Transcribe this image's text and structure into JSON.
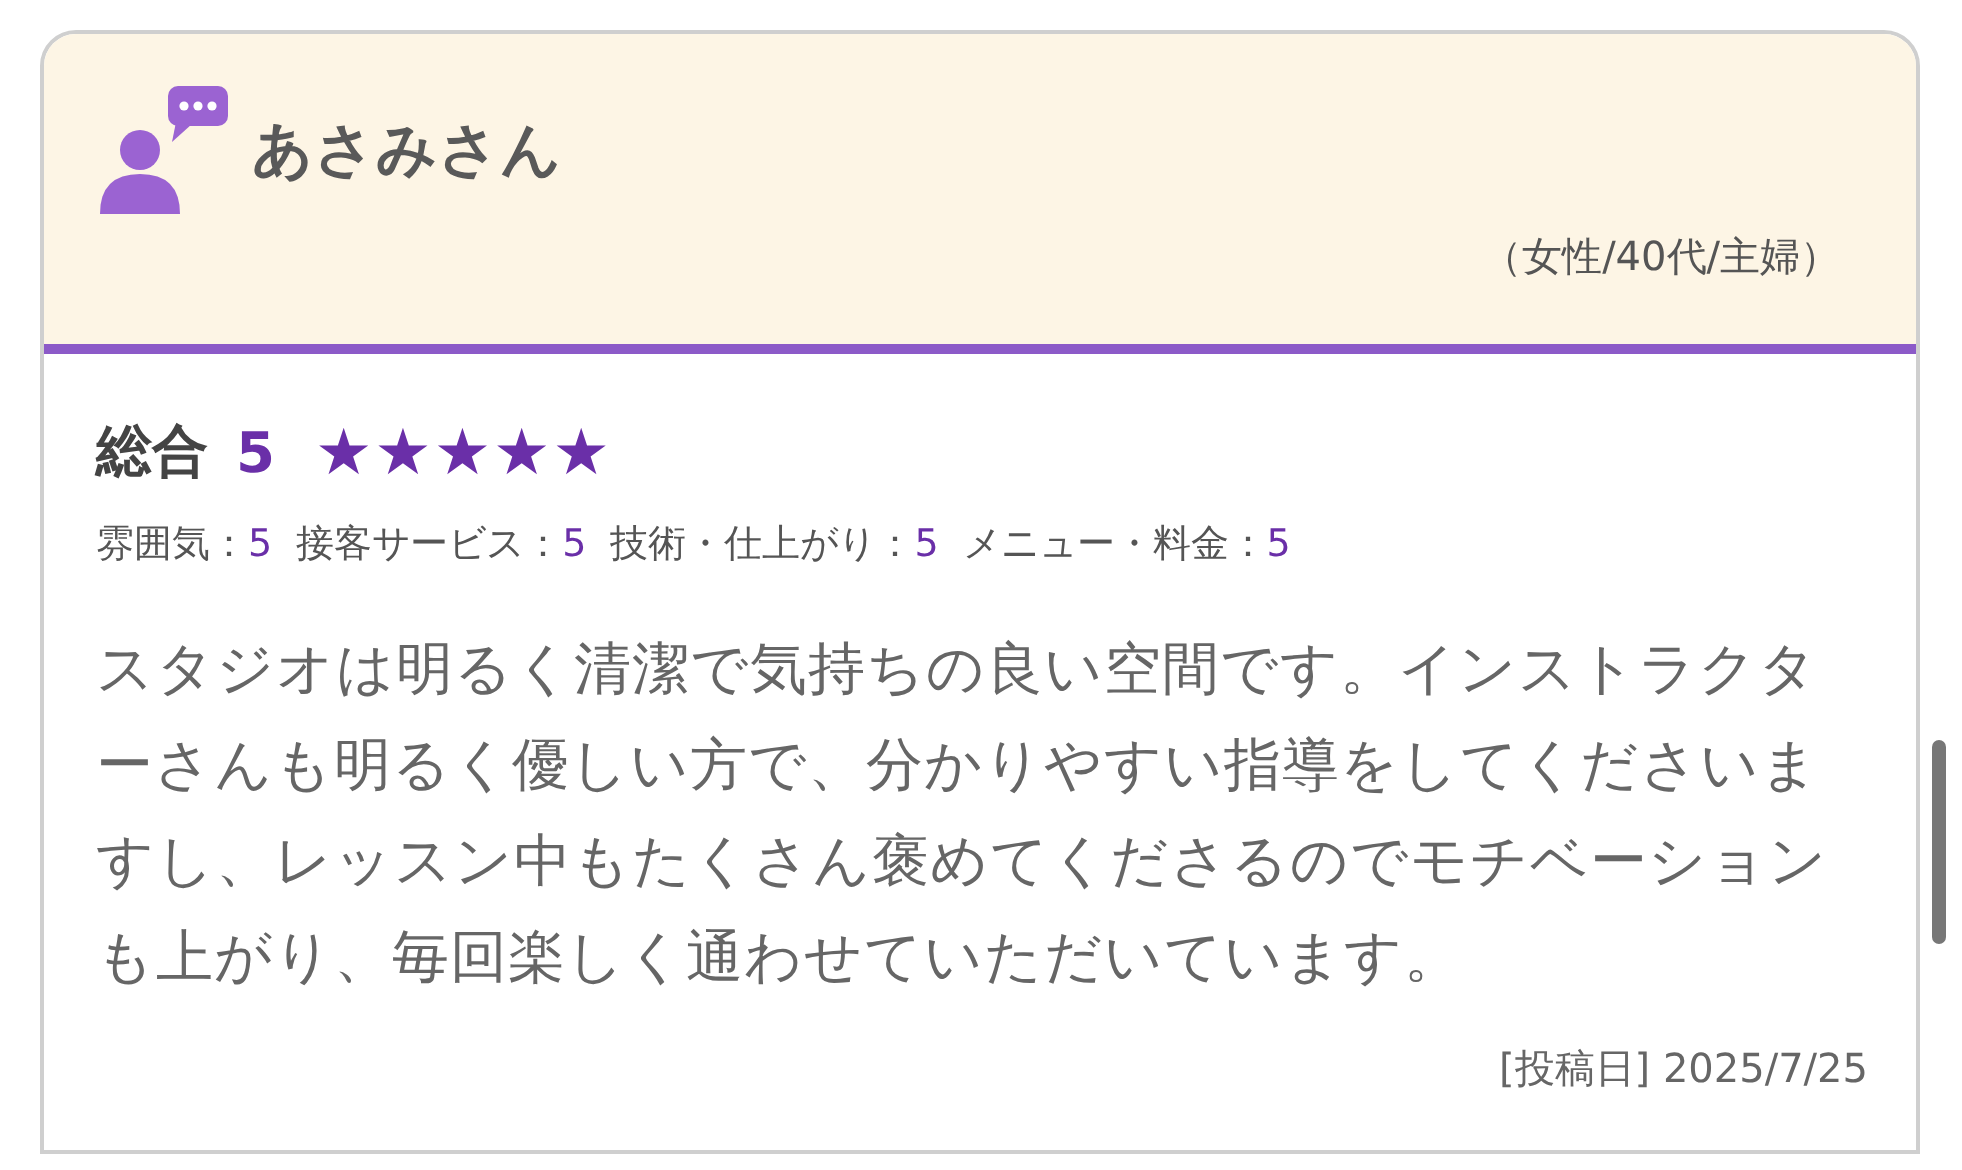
{
  "review": {
    "reviewer": "あさみさん",
    "profile": "（女性/40代/主婦）",
    "overall": {
      "label": "総合",
      "score": "5",
      "stars": 5
    },
    "sub_ratings": [
      {
        "label": "雰囲気：",
        "value": "5"
      },
      {
        "label": "接客サービス：",
        "value": "5"
      },
      {
        "label": "技術・仕上がり：",
        "value": "5"
      },
      {
        "label": "メニュー・料金：",
        "value": "5"
      }
    ],
    "comment": "スタジオは明るく清潔で気持ちの良い空間です。インストラクターさんも明るく優しい方で、分かりやすい指導をしてくださいますし、レッスン中もたくさん褒めてくださるのでモチベーションも上がり、毎回楽しく通わせていただいています。",
    "posted": "[投稿日] 2025/7/25"
  }
}
